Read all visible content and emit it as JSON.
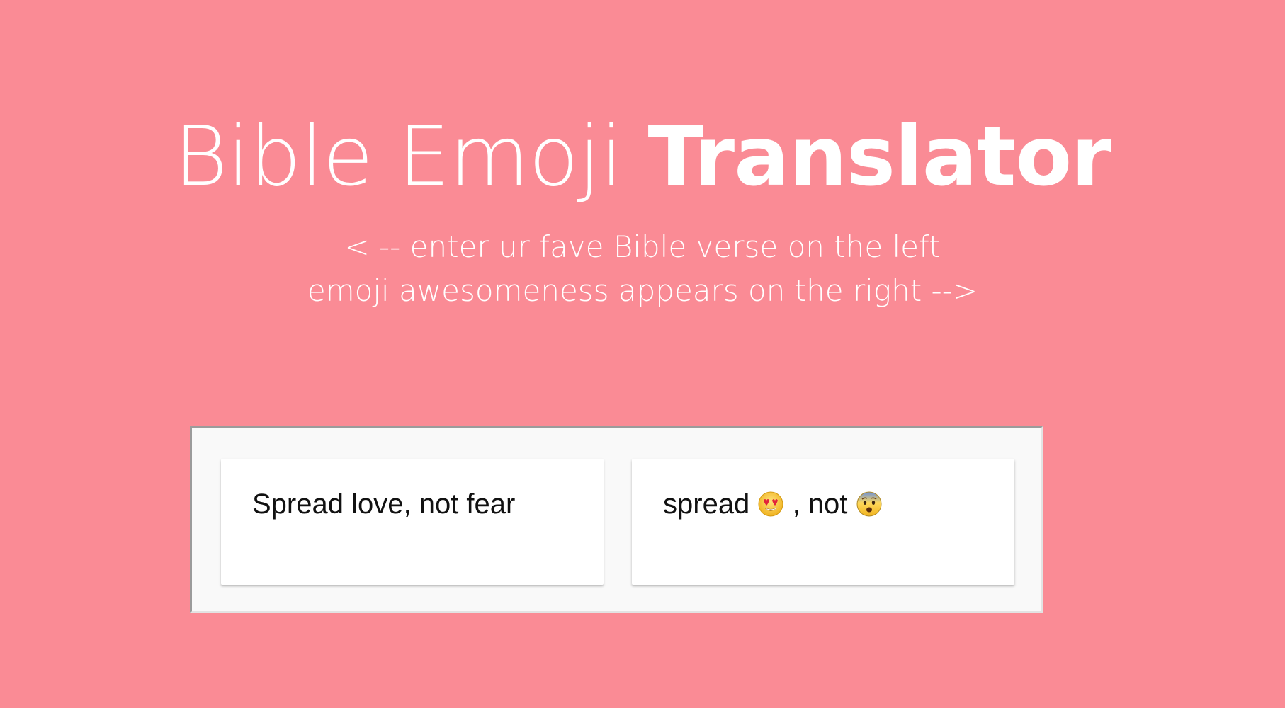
{
  "header": {
    "title_light": "Bible Emoji",
    "title_bold": "Translator",
    "subtitle_line1": "< -- enter ur fave Bible verse on the left",
    "subtitle_line2": "emoji awesomeness appears on the right -->"
  },
  "translator": {
    "input_text": "Spread love, not fear",
    "output_text_part1": "spread",
    "output_text_part2": ", not",
    "emoji_love_icon": "heart-eyes-icon",
    "emoji_fear_icon": "fearful-face-icon"
  },
  "colors": {
    "background": "#fa8b95",
    "panel": "#f9f9f9",
    "box": "#ffffff"
  }
}
